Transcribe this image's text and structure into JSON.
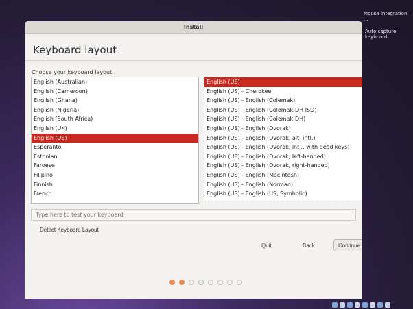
{
  "notifications": [
    "Mouse integration ...",
    "Auto capture keyboard"
  ],
  "window": {
    "title": "Install",
    "page_title": "Keyboard layout",
    "prompt": "Choose your keyboard layout:"
  },
  "layouts": [
    {
      "label": "English (Australian)",
      "selected": false
    },
    {
      "label": "English (Cameroon)",
      "selected": false
    },
    {
      "label": "English (Ghana)",
      "selected": false
    },
    {
      "label": "English (Nigeria)",
      "selected": false
    },
    {
      "label": "English (South Africa)",
      "selected": false
    },
    {
      "label": "English (UK)",
      "selected": false
    },
    {
      "label": "English (US)",
      "selected": true
    },
    {
      "label": "Esperanto",
      "selected": false
    },
    {
      "label": "Estonian",
      "selected": false
    },
    {
      "label": "Faroese",
      "selected": false
    },
    {
      "label": "Filipino",
      "selected": false
    },
    {
      "label": "Finnish",
      "selected": false
    },
    {
      "label": "French",
      "selected": false
    }
  ],
  "variants": [
    {
      "label": "English (US)",
      "selected": true
    },
    {
      "label": "English (US) - Cherokee",
      "selected": false
    },
    {
      "label": "English (US) - English (Colemak)",
      "selected": false
    },
    {
      "label": "English (US) - English (Colemak-DH ISO)",
      "selected": false
    },
    {
      "label": "English (US) - English (Colemak-DH)",
      "selected": false
    },
    {
      "label": "English (US) - English (Dvorak)",
      "selected": false
    },
    {
      "label": "English (US) - English (Dvorak, alt. intl.)",
      "selected": false
    },
    {
      "label": "English (US) - English (Dvorak, intl., with dead keys)",
      "selected": false
    },
    {
      "label": "English (US) - English (Dvorak, left-handed)",
      "selected": false
    },
    {
      "label": "English (US) - English (Dvorak, right-handed)",
      "selected": false
    },
    {
      "label": "English (US) - English (Macintosh)",
      "selected": false
    },
    {
      "label": "English (US) - English (Norman)",
      "selected": false
    },
    {
      "label": "English (US) - English (US, Symbolic)",
      "selected": false
    }
  ],
  "test_input": {
    "placeholder": "Type here to test your keyboard",
    "value": ""
  },
  "buttons": {
    "detect": "Detect Keyboard Layout",
    "quit": "Quit",
    "back": "Back",
    "continue": "Continue"
  },
  "progress": {
    "total_steps": 8,
    "completed_steps": 2
  },
  "colors": {
    "selection": "#c7281f",
    "progress_done": "#e98b58"
  }
}
